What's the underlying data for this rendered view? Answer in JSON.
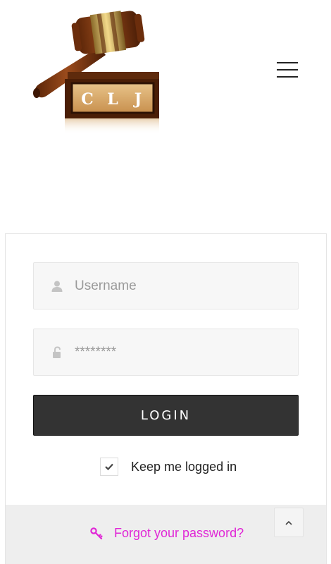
{
  "header": {
    "logo_letters": [
      "C",
      "L",
      "J"
    ],
    "menu_icon": "hamburger-menu-icon"
  },
  "login_form": {
    "username": {
      "placeholder": "Username",
      "value": "",
      "icon": "user-icon"
    },
    "password": {
      "placeholder": "********",
      "value": "",
      "icon": "unlock-icon"
    },
    "login_button_label": "LOGIN",
    "remember": {
      "label": "Keep me logged in",
      "checked": true
    },
    "forgot_password": {
      "label": "Forgot your password?",
      "icon": "key-icon"
    }
  },
  "scroll_to_top_icon": "chevron-up-icon",
  "colors": {
    "button_bg": "#333333",
    "link_accent": "#e026d6",
    "footer_bg": "#eeeeee",
    "field_bg": "#f7f7f7"
  }
}
